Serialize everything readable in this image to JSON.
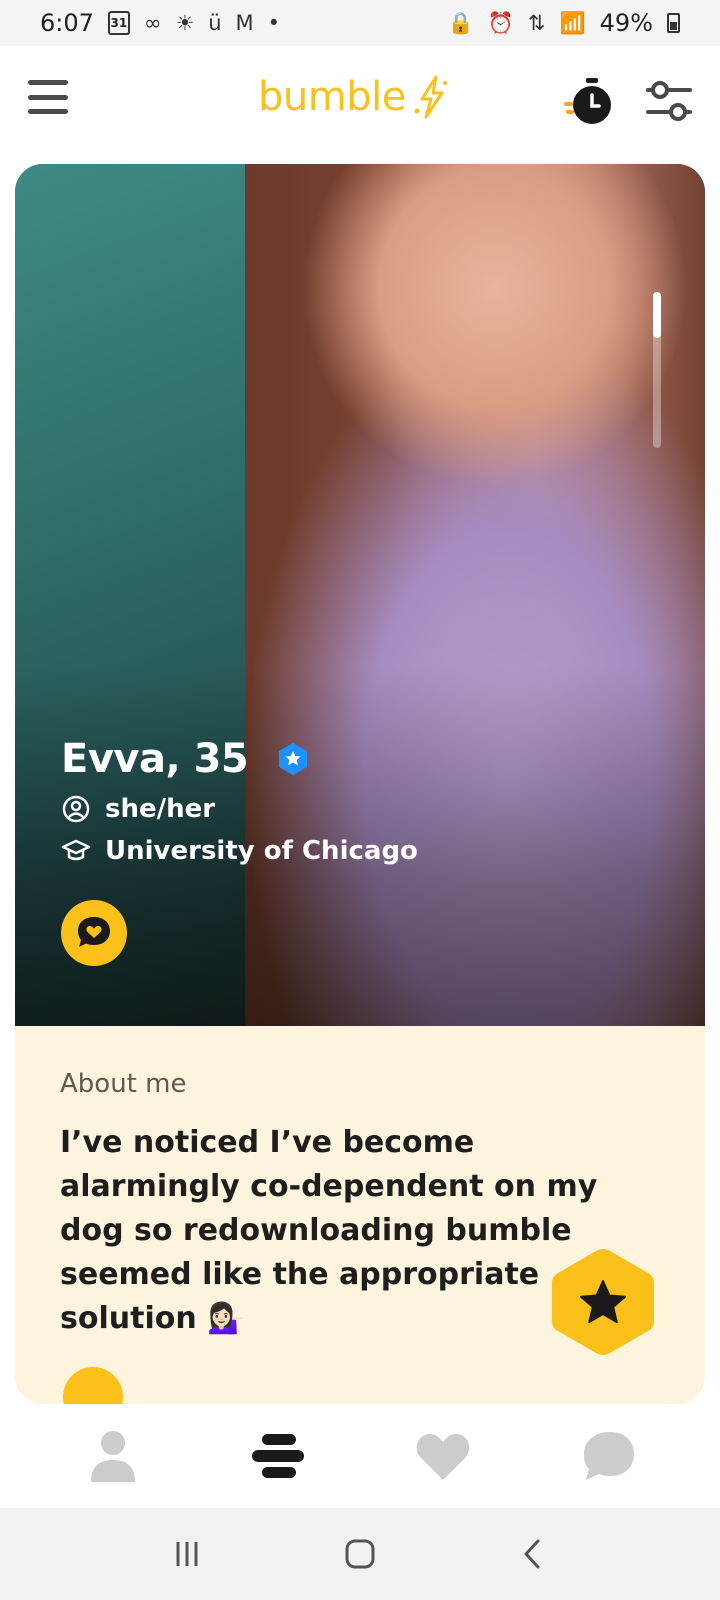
{
  "status_bar": {
    "time": "6:07",
    "calendar_day": "31",
    "battery_percent": "49%",
    "icons": [
      "calendar-icon",
      "voicemail-icon",
      "brightness-icon",
      "app-icon",
      "gmail-icon",
      "dot-icon",
      "lock-icon",
      "alarm-icon",
      "data-icon",
      "signal-icon",
      "battery-icon"
    ]
  },
  "header": {
    "brand_name": "bumble"
  },
  "profile": {
    "name_age": "Evva, 35",
    "pronouns": "she/her",
    "school": "University of Chicago",
    "verified": true,
    "photo_index": 1
  },
  "about": {
    "heading": "About me",
    "text": "I’ve noticed I’ve become alarmingly co-dependent on my dog so redownloading bumble seemed like the appropriate solution 💁🏻‍♀️"
  },
  "bottom_nav": {
    "items": [
      "profile",
      "people",
      "likes",
      "chats"
    ],
    "active": "people"
  },
  "colors": {
    "brand_yellow": "#fcc01a",
    "card_cream": "#fdf4dd",
    "verified_blue": "#1e90ff",
    "nav_inactive": "#cccccc",
    "nav_active": "#1a1a1a"
  }
}
